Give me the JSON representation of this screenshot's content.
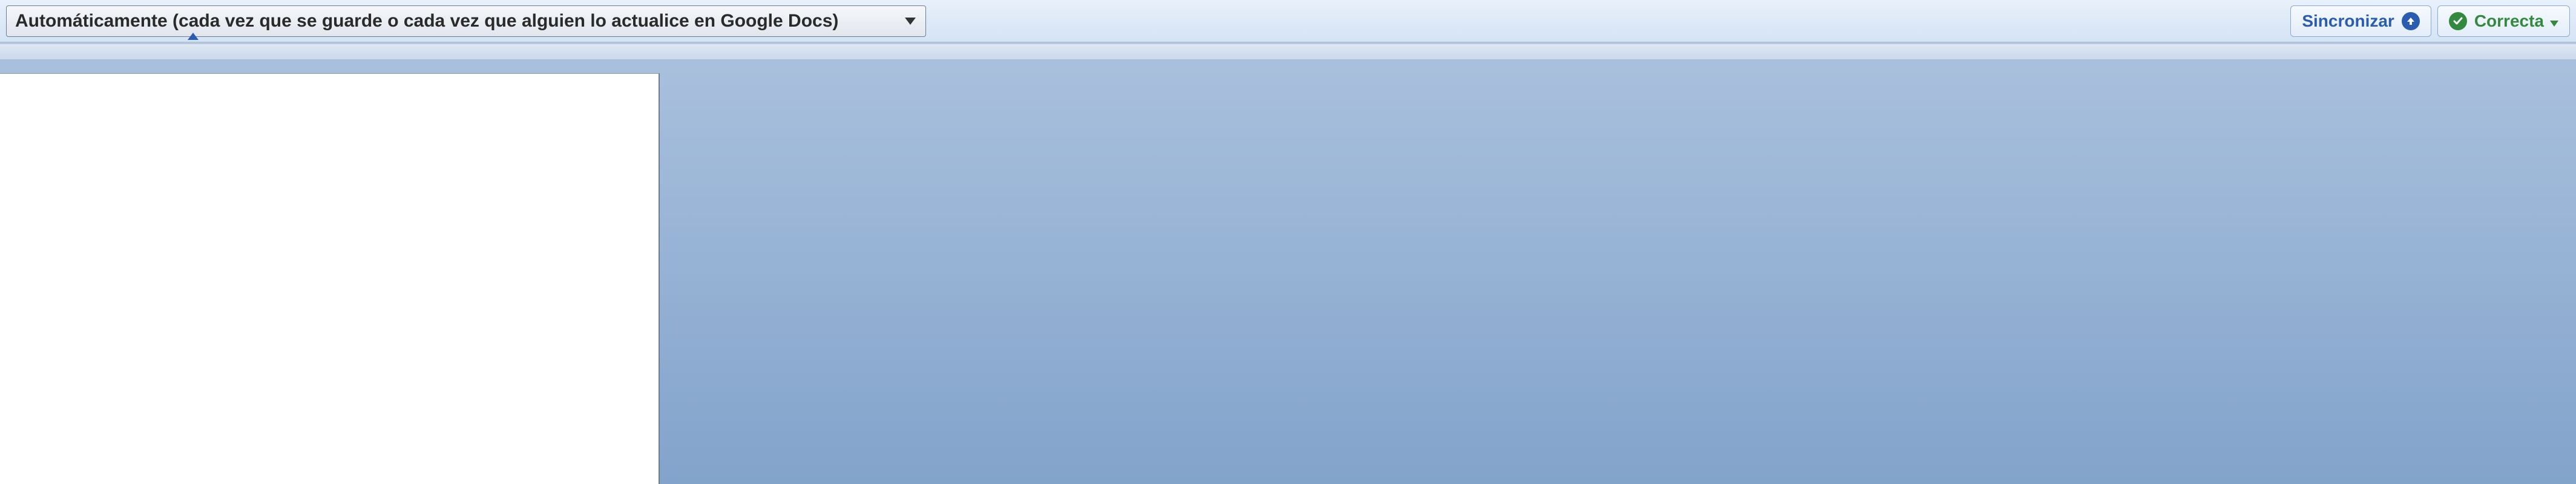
{
  "toolbar": {
    "dropdown": {
      "selected": "Automáticamente (cada vez que se guarde o cada vez que alguien lo actualice en Google Docs)"
    },
    "sync_button": {
      "label": "Sincronizar"
    },
    "status_button": {
      "label": "Correcta"
    }
  },
  "colors": {
    "accent_blue": "#2a5db0",
    "status_green": "#338a3e"
  }
}
